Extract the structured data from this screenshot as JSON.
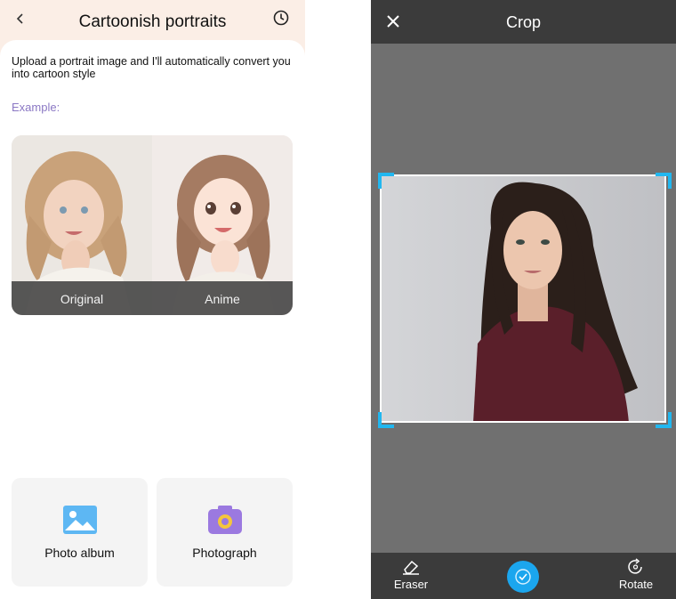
{
  "left_screen": {
    "title": "Cartoonish portraits",
    "description": "Upload a portrait image and I'll automatically convert you into cartoon style",
    "example_label": "Example:",
    "example_captions": [
      "Original",
      "Anime"
    ],
    "actions": [
      {
        "label": "Photo album",
        "icon": "image-icon"
      },
      {
        "label": "Photograph",
        "icon": "camera-icon"
      }
    ],
    "colors": {
      "header_bg": "#fbeee6",
      "example_label": "#8b78c4",
      "album_icon": "#5db7f3",
      "camera_icon": "#9b79e0"
    }
  },
  "right_screen": {
    "title": "Crop",
    "tools": {
      "eraser": "Eraser",
      "rotate": "Rotate"
    },
    "colors": {
      "header_bg": "#3b3b3b",
      "canvas_bg": "#707070",
      "accent": "#21b7f0"
    }
  }
}
